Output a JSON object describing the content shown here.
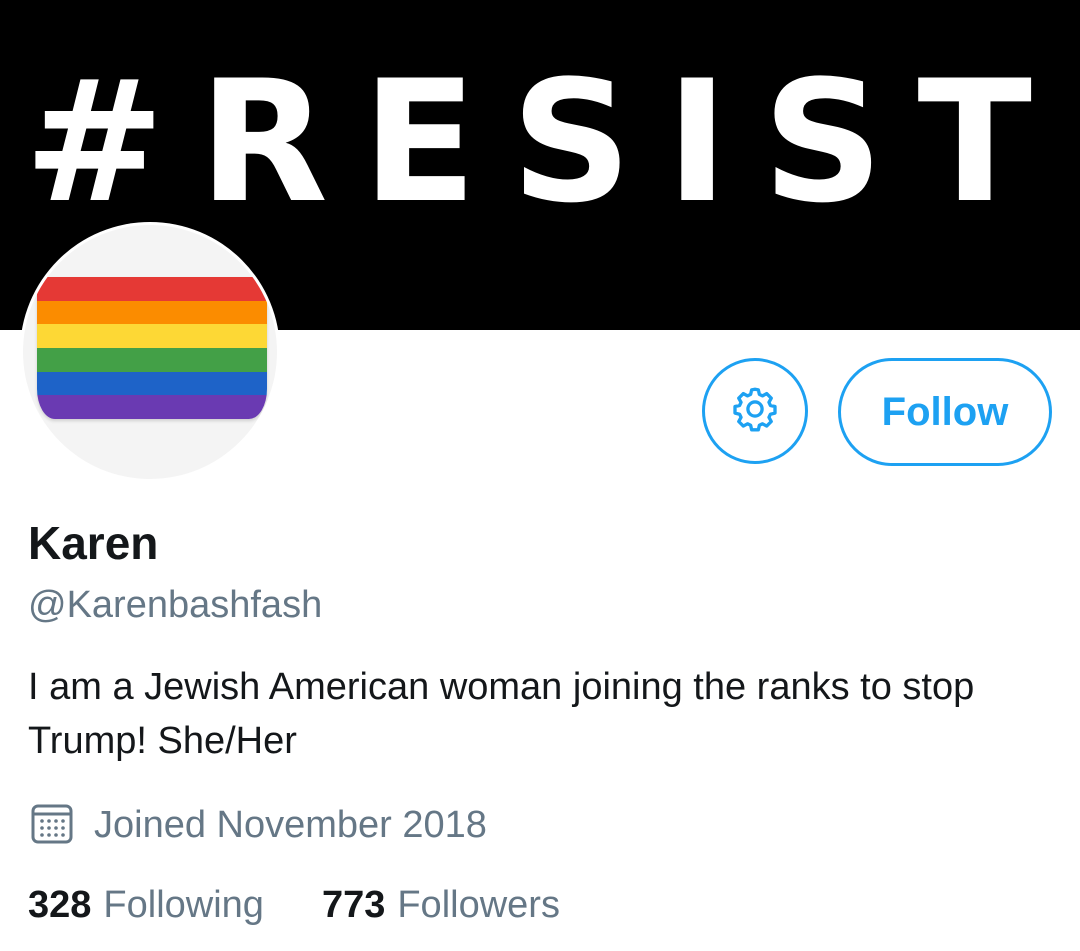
{
  "banner": {
    "text": "#RESIST"
  },
  "avatar": {
    "description": "rainbow-flag",
    "flag_colors": [
      "#e53935",
      "#fb8c00",
      "#fdd835",
      "#43a047",
      "#1e63c8",
      "#6a3ab2"
    ]
  },
  "actions": {
    "settings_icon": "gear-icon",
    "follow_label": "Follow"
  },
  "profile": {
    "name": "Karen",
    "handle": "@Karenbashfash",
    "bio": "I am a Jewish American woman joining the ranks to stop Trump!  She/Her",
    "joined_icon": "calendar-icon",
    "joined": "Joined November 2018"
  },
  "stats": {
    "following_count": "328",
    "following_label": "Following",
    "followers_count": "773",
    "followers_label": "Followers"
  },
  "colors": {
    "accent": "#1da1f2",
    "text_primary": "#14171a",
    "text_secondary": "#657786",
    "banner_bg": "#000000"
  }
}
